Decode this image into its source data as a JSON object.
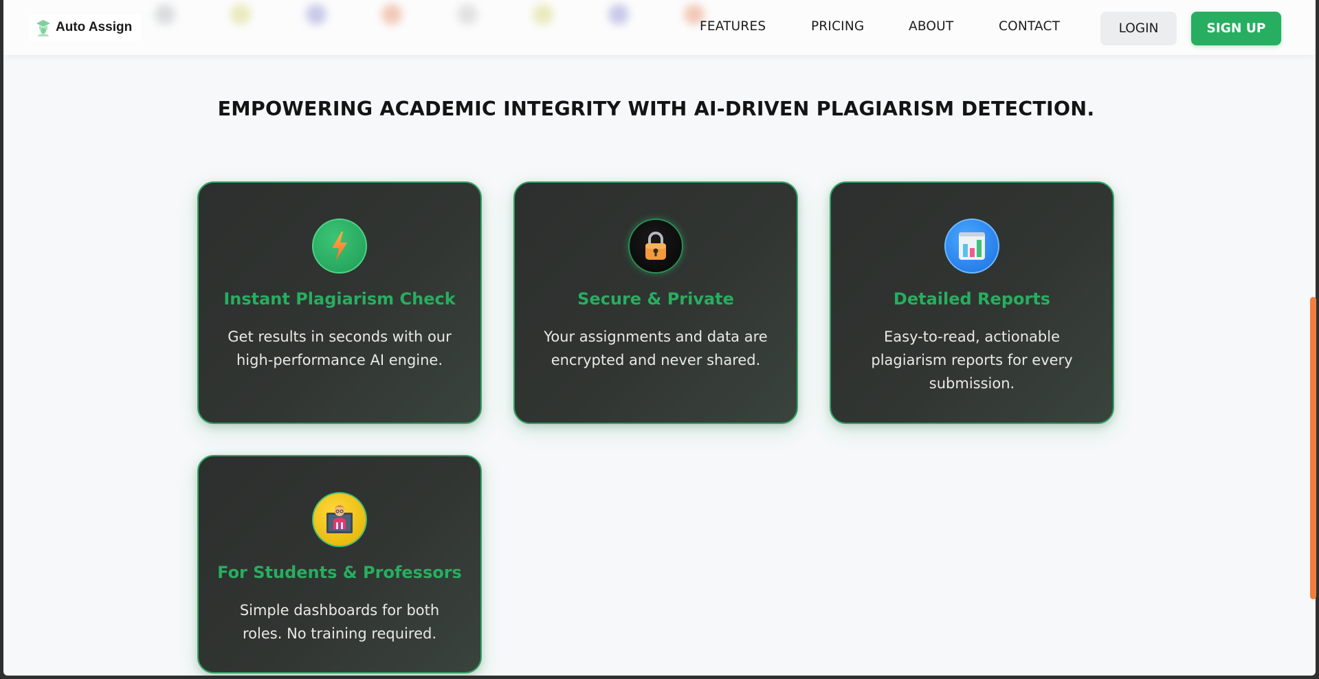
{
  "brand": {
    "name": "Auto Assign"
  },
  "nav": {
    "links": [
      "FEATURES",
      "PRICING",
      "ABOUT",
      "CONTACT"
    ],
    "login_label": "LOGIN",
    "signup_label": "SIGN UP"
  },
  "headline": "EMPOWERING ACADEMIC INTEGRITY WITH AI-DRIVEN PLAGIARISM DETECTION.",
  "features": [
    {
      "icon": "lightning-icon",
      "title": "Instant Plagiarism Check",
      "description": "Get results in seconds with our high-performance AI engine."
    },
    {
      "icon": "lock-icon",
      "title": "Secure & Private",
      "description": "Your assignments and data are encrypted and never shared."
    },
    {
      "icon": "bar-chart-icon",
      "title": "Detailed Reports",
      "description": "Easy-to-read, actionable plagiarism reports for every submission."
    },
    {
      "icon": "teacher-icon",
      "title": "For Students & Professors",
      "description": "Simple dashboards for both roles. No training required."
    }
  ],
  "colors": {
    "accent": "#27ae60",
    "card_background": "#2f3331",
    "page_background": "#f6f8f9",
    "scrollbar": "#f07f3e"
  }
}
